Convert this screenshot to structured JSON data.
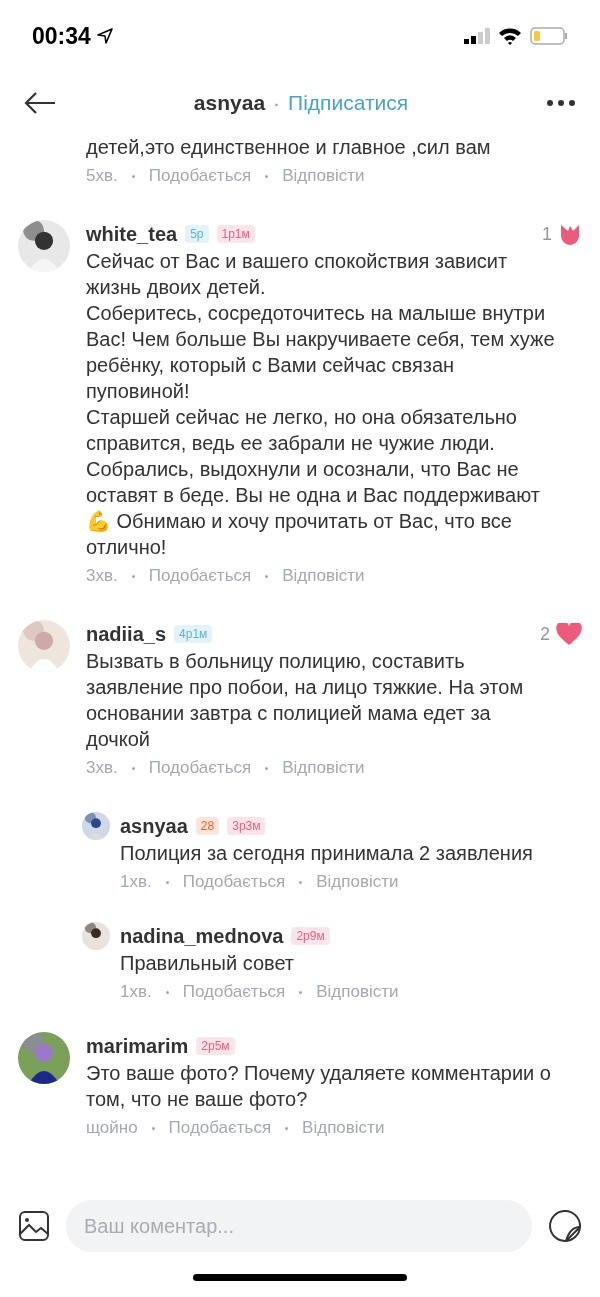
{
  "status_bar": {
    "time": "00:34"
  },
  "header": {
    "title": "asnyaa",
    "separator": "·",
    "follow": "Підписатися"
  },
  "comments": [
    {
      "kind": "partial",
      "text": "детей,это единственное и главное ,сил вам",
      "time": "5хв.",
      "like": "Подобається",
      "reply": "Відповісти"
    },
    {
      "kind": "comment",
      "user": "white_tea",
      "badges": [
        {
          "text": "5р",
          "color": "#5ab4d6"
        },
        {
          "text": "1р1м",
          "color": "#e8607e"
        }
      ],
      "reaction": {
        "count": "1",
        "kind": "tulip"
      },
      "text": "Сейчас от Вас и вашего спокойствия зависит жизнь двоих детей.\nСоберитесь, сосредоточитесь на малыше внутри Вас! Чем больше Вы накручиваете себя, тем хуже ребёнку, который с Вами сейчас связан пуповиной!\nСтаршей сейчас не легко, но она обязательно справится, ведь ее забрали не чужие люди. Собрались, выдохнули и осознали, что Вас не оставят в беде. Вы не одна и Вас поддерживают💪 Обнимаю и хочу прочитать от Вас, что все отлично!",
      "time": "3хв.",
      "like": "Подобається",
      "reply": "Відповісти"
    },
    {
      "kind": "comment",
      "user": "nadiia_s",
      "badges": [
        {
          "text": "4р1м",
          "color": "#5ab4d6"
        }
      ],
      "reaction": {
        "count": "2",
        "kind": "heart"
      },
      "text": "Вызвать в больницу полицию, составить заявление про побои, на лицо тяжкие. На этом основании завтра с полицией мама едет за дочкой",
      "time": "3хв.",
      "like": "Подобається",
      "reply": "Відповісти",
      "children": [
        {
          "kind": "comment",
          "user": "asnyaa",
          "badges": [
            {
              "text": "28",
              "color": "#e8622c"
            },
            {
              "text": "3р3м",
              "color": "#e8607e"
            }
          ],
          "text": "Полиция за сегодня принимала 2 заявления",
          "time": "1хв.",
          "like": "Подобається",
          "reply": "Відповісти"
        },
        {
          "kind": "comment",
          "user": "nadina_mednova",
          "badges": [
            {
              "text": "2р9м",
              "color": "#e8607e"
            }
          ],
          "text": "Правильный совет",
          "time": "1хв.",
          "like": "Подобається",
          "reply": "Відповісти"
        }
      ]
    },
    {
      "kind": "comment",
      "user": "marimarim",
      "badges": [
        {
          "text": "2р5м",
          "color": "#e8607e"
        }
      ],
      "text": "Это ваше фото? Почему удаляете комментарии о том, что не ваше фото?",
      "time": "щойно",
      "like": "Подобається",
      "reply": "Відповісти"
    }
  ],
  "composer": {
    "placeholder": "Ваш коментар..."
  }
}
